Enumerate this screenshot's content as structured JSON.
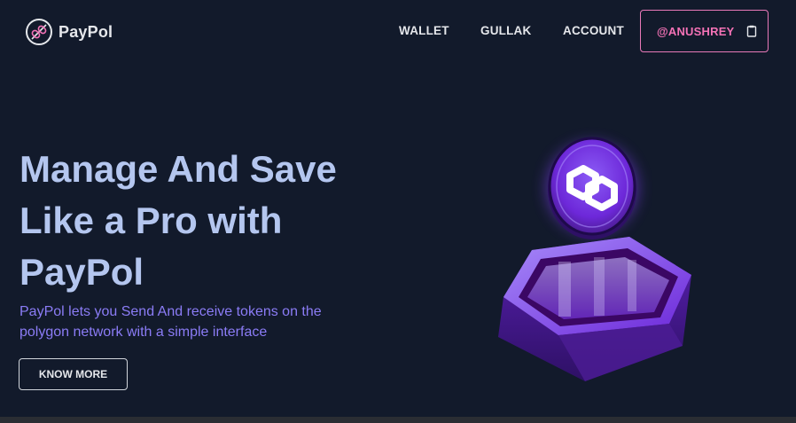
{
  "brand": {
    "name": "PayPol",
    "logo_icon": "link-icon"
  },
  "nav": {
    "items": [
      {
        "label": "WALLET"
      },
      {
        "label": "GULLAK"
      },
      {
        "label": "ACCOUNT"
      }
    ],
    "account_button": {
      "label": "@ANUSHREY",
      "icon": "copy-icon"
    }
  },
  "hero": {
    "title_lines": [
      "Manage And Save",
      "Like a Pro with",
      "PayPol"
    ],
    "subtitle_lines": [
      "PayPol lets you Send And receive tokens on the",
      "polygon network with a simple interface"
    ],
    "cta_label": "KNOW MORE",
    "illustration_icon": "polygon-logo-icon"
  },
  "colors": {
    "background": "#121a2b",
    "title": "#b4c6ef",
    "subtitle": "#8b7cf6",
    "accent_pink": "#f472b6",
    "polygon_purple": "#7b3fe4"
  }
}
